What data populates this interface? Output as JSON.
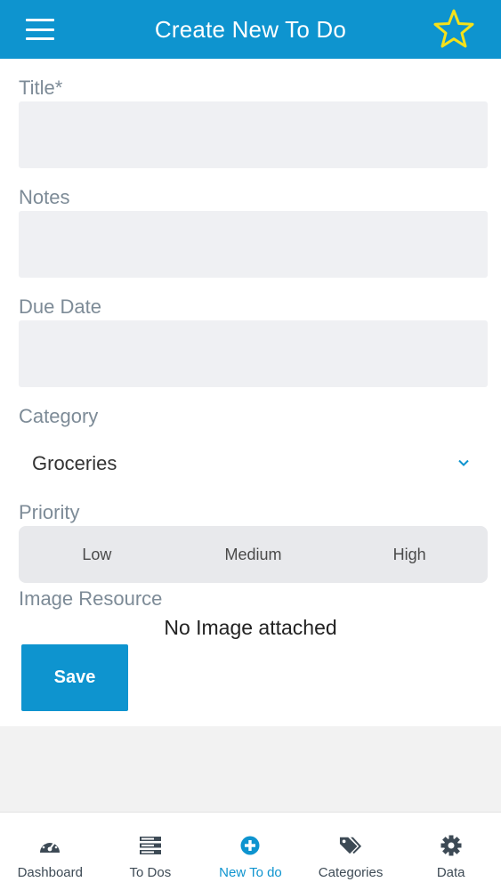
{
  "header": {
    "title": "Create New To Do",
    "menu_icon": "hamburger-menu-icon",
    "favorite_icon": "star-outline-icon",
    "star_color": "#f5e11a",
    "background": "#0e94cf"
  },
  "form": {
    "title_label": "Title*",
    "title_value": "",
    "notes_label": "Notes",
    "notes_value": "",
    "due_date_label": "Due Date",
    "due_date_value": "",
    "category_label": "Category",
    "category_value": "Groceries",
    "priority_label": "Priority",
    "priority_options": [
      "Low",
      "Medium",
      "High"
    ],
    "image_label": "Image Resource",
    "image_status": "No Image attached",
    "save_label": "Save"
  },
  "tabs": [
    {
      "label": "Dashboard",
      "icon": "dashboard-gauge-icon"
    },
    {
      "label": "To Dos",
      "icon": "list-icon"
    },
    {
      "label": "New To do",
      "icon": "plus-circle-icon",
      "active": true
    },
    {
      "label": "Categories",
      "icon": "tags-icon"
    },
    {
      "label": "Data",
      "icon": "gear-icon"
    }
  ],
  "colors": {
    "accent": "#0e94cf",
    "label": "#7d8b97",
    "field_bg": "#eff0f3"
  }
}
